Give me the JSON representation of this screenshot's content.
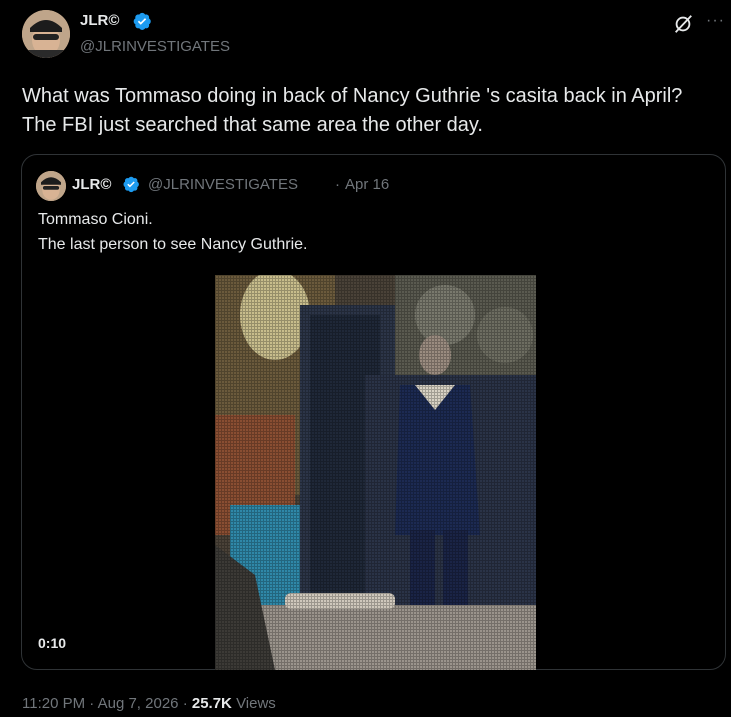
{
  "author": {
    "name": "JLR©",
    "handle": "@JLRINVESTIGATES",
    "avatar_icon": "profile-photo",
    "verified_color": "#1d9bf0"
  },
  "tweet": {
    "text": "What was Tommaso doing in back of Nancy Guthrie 's casita back in April? The FBI just searched that same area the other day."
  },
  "quoted": {
    "name": "JLR©",
    "handle": "@JLRINVESTIGATES",
    "separator": "·",
    "date": "Apr 16",
    "text_line1": "Tommaso Cioni.",
    "text_line2": "The last person to see Nancy Guthrie.",
    "video_duration": "0:10"
  },
  "meta": {
    "time": "11:20 PM",
    "sep1": "·",
    "date": "Aug 7, 2026",
    "sep2": "·",
    "views_count": "25.7K",
    "views_label": "Views"
  },
  "icons": {
    "grok": "grok-icon",
    "more": "more-icon",
    "more_glyph": "···"
  }
}
